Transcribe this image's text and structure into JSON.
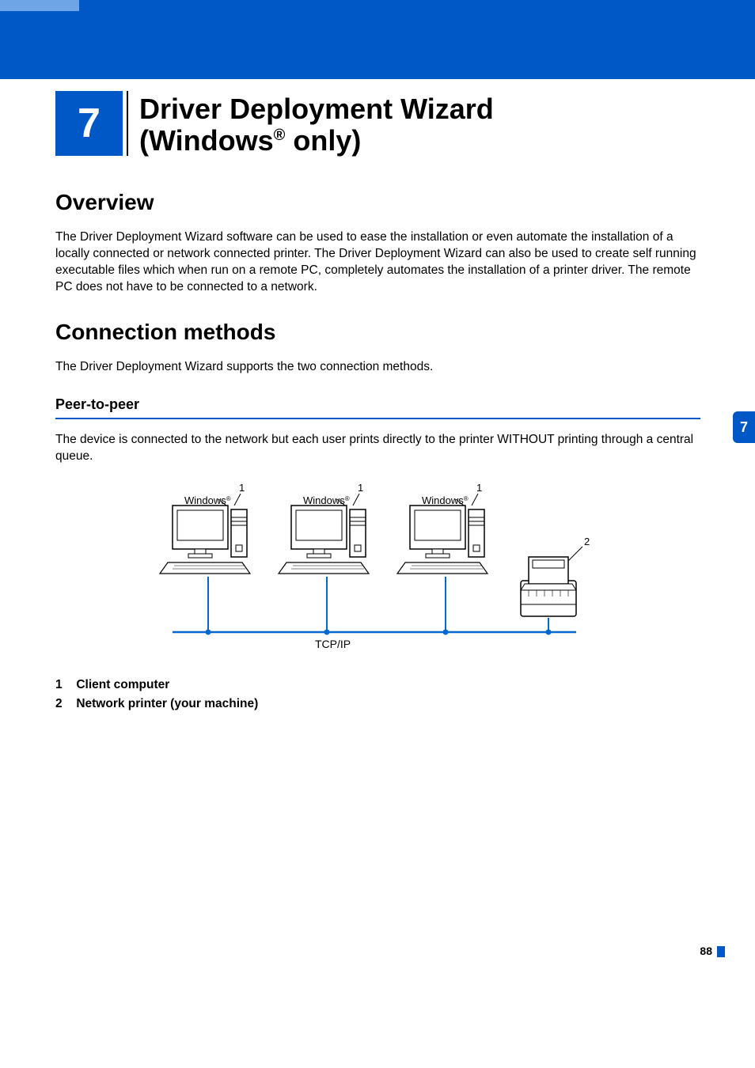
{
  "chapter": {
    "number": "7",
    "title_line1": "Driver Deployment Wizard",
    "title_line2_prefix": "(Windows",
    "title_line2_suffix": " only)"
  },
  "sections": {
    "overview": {
      "heading": "Overview",
      "text": "The Driver Deployment Wizard software can be used to ease the installation or even automate the installation of a locally connected or network connected printer. The Driver Deployment Wizard can also be used to create self running executable files which when run on a remote PC, completely automates the installation of a printer driver. The remote PC does not have to be connected to a network."
    },
    "connection_methods": {
      "heading": "Connection methods",
      "text": "The Driver Deployment Wizard supports the two connection methods.",
      "peer_to_peer": {
        "heading": "Peer-to-peer",
        "text": "The device is connected to the network but each user prints directly to the printer WITHOUT printing through a central queue."
      }
    }
  },
  "figure": {
    "client_label": "Windows",
    "callout_client": "1",
    "callout_printer": "2",
    "protocol": "TCP/IP"
  },
  "legend": [
    {
      "num": "1",
      "label": "Client computer"
    },
    {
      "num": "2",
      "label": "Network printer (your machine)"
    }
  ],
  "tab": "7",
  "page_number": "88"
}
